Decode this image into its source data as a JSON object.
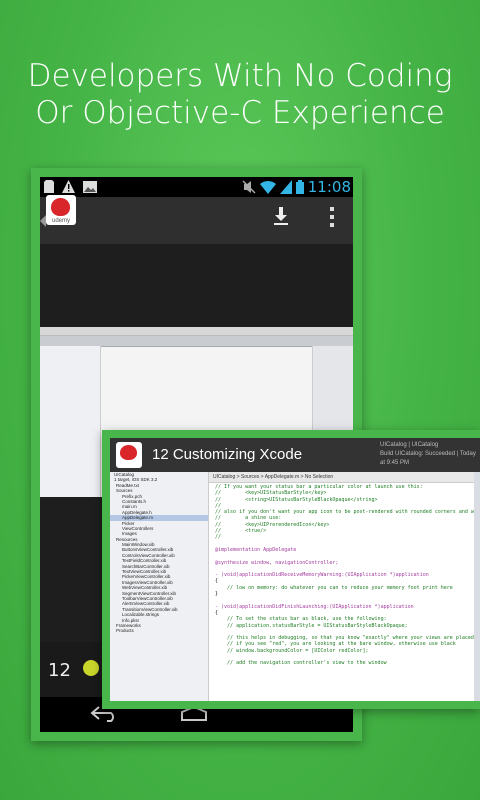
{
  "headline": {
    "line1": "Developers With No Coding",
    "line2": "Or Objective-C Experience"
  },
  "phone": {
    "status_time": "11:08",
    "video_chapter": "12",
    "logo_text": "udemy"
  },
  "tablet": {
    "lecture_title": "12  Customizing Xcode",
    "tabs": [
      "UICatalog | UICatalog",
      "Build UICatalog: Succeeded | Today at 9:45 PM"
    ],
    "jump_bar": "UICatalog > Sources > AppDelegate.m > No Selection",
    "files": [
      "UICatalog",
      "1 target, iOS SDK 3.2",
      "ReadMe.txt",
      "Sources",
      "Prefix.pch",
      "Constants.h",
      "main.m",
      "AppDelegate.h",
      "AppDelegate.m",
      "Picker",
      "ViewControllers",
      "Images",
      "Resources",
      "MainWindow.xib",
      "ButtonsViewController.xib",
      "ControlsViewController.xib",
      "TextFieldController.xib",
      "SearchBarController.xib",
      "TextViewController.xib",
      "PickerViewController.xib",
      "ImagesViewController.xib",
      "WebViewController.xib",
      "SegmentViewController.xib",
      "ToolbarViewController.xib",
      "AlertsViewController.xib",
      "TransitionViewController.xib",
      "Localizable.strings",
      "Info.plist",
      "Frameworks",
      "Products"
    ],
    "code": [
      {
        "t": "c",
        "s": "// If you want your status bar a particular color at launch use this:"
      },
      {
        "t": "c",
        "s": "//        <key>UIStatusBarStyle</key>"
      },
      {
        "t": "c",
        "s": "//        <string>UIStatusBarStyleBlackOpaque</string>"
      },
      {
        "t": "c",
        "s": "//"
      },
      {
        "t": "c",
        "s": "// also if you don't want your app icon to be post-rendered with rounded corners and with"
      },
      {
        "t": "c",
        "s": "//        a shine use:"
      },
      {
        "t": "c",
        "s": "//        <key>UIPrerenderedIcon</key>"
      },
      {
        "t": "c",
        "s": "//        <true/>"
      },
      {
        "t": "c",
        "s": "//"
      },
      {
        "t": "x",
        "s": ""
      },
      {
        "t": "k",
        "s": "@implementation AppDelegate"
      },
      {
        "t": "x",
        "s": ""
      },
      {
        "t": "k",
        "s": "@synthesize window, navigationController;"
      },
      {
        "t": "x",
        "s": ""
      },
      {
        "t": "k",
        "s": "- (void)applicationDidReceiveMemoryWarning:(UIApplication *)application"
      },
      {
        "t": "x",
        "s": "{"
      },
      {
        "t": "c",
        "s": "    // low on memory: do whatever you can to reduce your memory foot print here"
      },
      {
        "t": "x",
        "s": "}"
      },
      {
        "t": "x",
        "s": ""
      },
      {
        "t": "k",
        "s": "- (void)applicationDidFinishLaunching:(UIApplication *)application"
      },
      {
        "t": "x",
        "s": "{"
      },
      {
        "t": "c",
        "s": "    // To set the status bar as black, use the following:"
      },
      {
        "t": "c",
        "s": "    // application.statusBarStyle = UIStatusBarStyleBlackOpaque;"
      },
      {
        "t": "x",
        "s": ""
      },
      {
        "t": "c",
        "s": "    // this helps in debugging, so that you know \"exactly\" where your views are placed;"
      },
      {
        "t": "c",
        "s": "    // if you see \"red\", you are looking at the bare window, otherwise use black"
      },
      {
        "t": "c",
        "s": "    // window.backgroundColor = [UIColor redColor];"
      },
      {
        "t": "x",
        "s": ""
      },
      {
        "t": "c",
        "s": "    // add the navigation controller's view to the window"
      }
    ]
  },
  "colors": {
    "background": "#45b446",
    "frame": "#48b64a",
    "time": "#33b5e5",
    "brand": "#d8262b"
  }
}
